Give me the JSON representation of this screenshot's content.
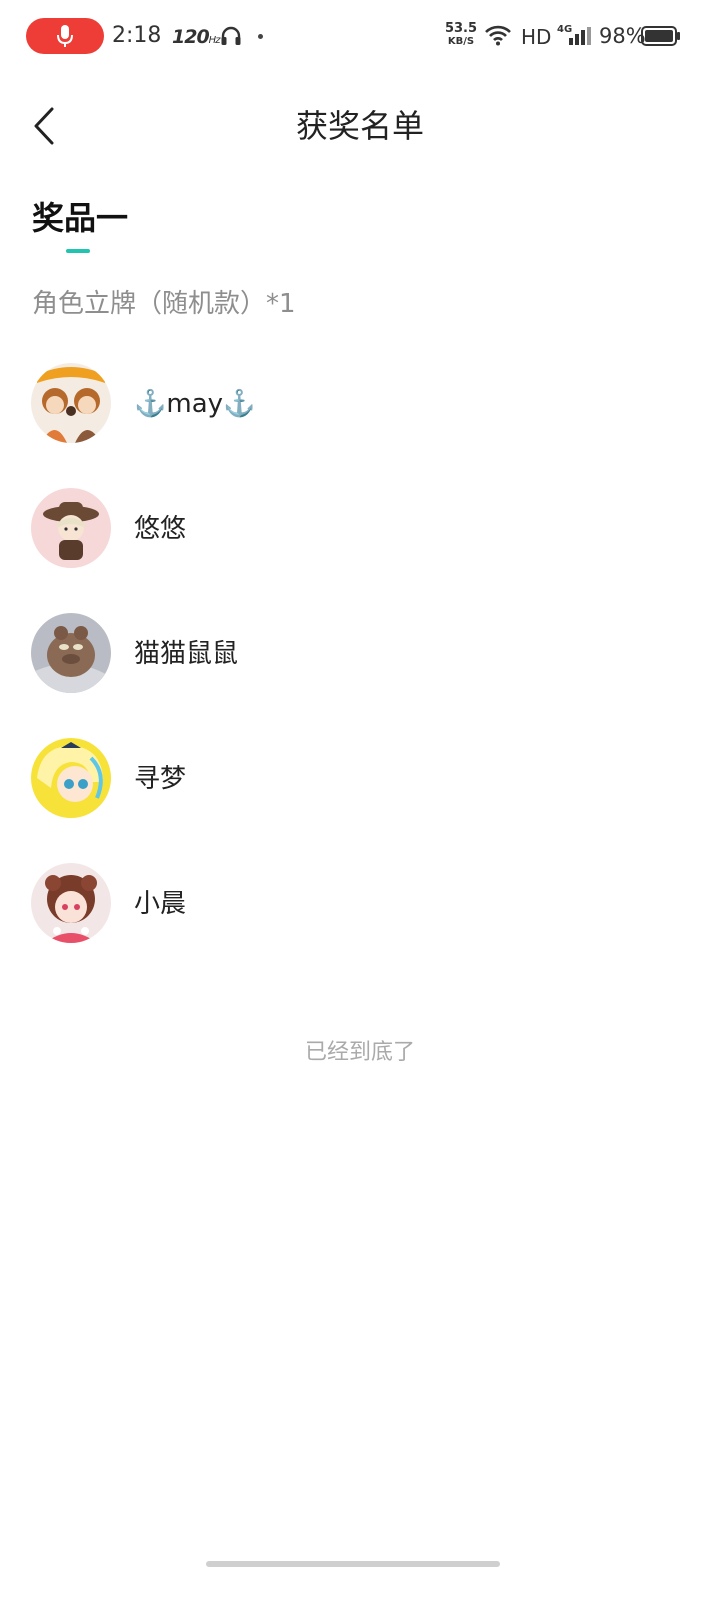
{
  "status_bar": {
    "time": "2:18",
    "refresh_rate": "120",
    "refresh_unit": "Hz",
    "net_speed_value": "53.5",
    "net_speed_unit": "KB/S",
    "hd_label": "HD",
    "network_type": "4G",
    "battery": "98%",
    "icons": [
      "mic-icon",
      "headphones-icon",
      "wifi-icon",
      "signal-icon",
      "battery-icon"
    ],
    "colors": {
      "mic_pill": "#ee3c36"
    }
  },
  "header": {
    "title": "获奖名单",
    "back_icon": "chevron-left-icon"
  },
  "tabs": [
    {
      "label": "奖品一",
      "active": true
    }
  ],
  "prize": {
    "description": "角色立牌（随机款）*1"
  },
  "winners": [
    {
      "name": "⚓️may⚓️"
    },
    {
      "name": "悠悠"
    },
    {
      "name": "猫猫鼠鼠"
    },
    {
      "name": "寻梦"
    },
    {
      "name": "小晨"
    }
  ],
  "footer": {
    "end_text": "已经到底了"
  },
  "colors": {
    "accent": "#21c3b1",
    "text_primary": "#222222",
    "text_secondary": "#8e8e8e",
    "text_hint": "#aaaaaa"
  }
}
